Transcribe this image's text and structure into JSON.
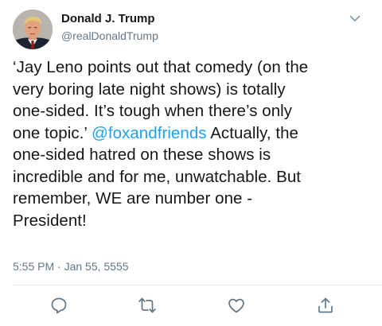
{
  "author": {
    "display_name": "Donald J. Trump",
    "handle": "@realDonaldTrump",
    "avatar_icon": "profile-photo"
  },
  "tweet": {
    "line1": "‘Jay Leno points out that comedy (on the",
    "line2": "very boring late night shows) is totally",
    "line3": "one-sided. It’s tough when there’s only",
    "line4_before": "one topic.’ ",
    "mention": "@foxandfriends",
    "line4_after": " Actually, the",
    "line5": "one-sided hatred on these shows is",
    "line6": "incredible and for me, unwatchable. But",
    "line7": "remember, WE are number one -",
    "line8": "President!"
  },
  "timestamp": "5:55 PM · Jan 55, 5555",
  "actions": {
    "reply_icon": "reply-icon",
    "retweet_icon": "retweet-icon",
    "like_icon": "heart-icon",
    "share_icon": "share-icon"
  },
  "colors": {
    "link": "#1da1f2",
    "secondary_text": "#657786",
    "primary_text": "#14171a",
    "icon_gray": "#657786",
    "divider": "#e6ecf0"
  }
}
